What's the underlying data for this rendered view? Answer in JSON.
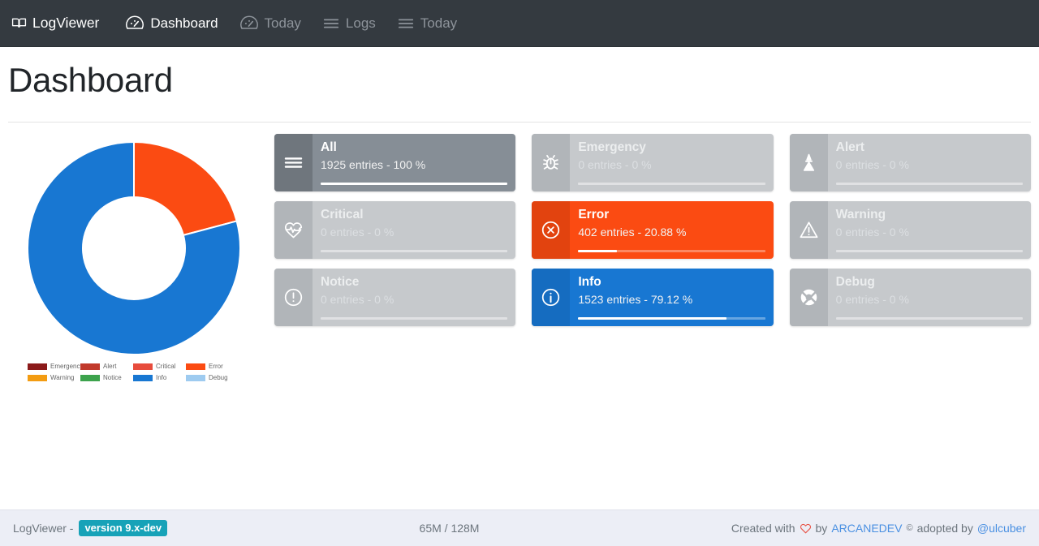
{
  "navbar": {
    "brand": {
      "label": "LogViewer",
      "icon": "book-open-icon"
    },
    "items": [
      {
        "label": "Dashboard",
        "icon": "tachometer-icon",
        "state": "active"
      },
      {
        "label": "Today",
        "icon": "tachometer-icon",
        "state": "muted"
      },
      {
        "label": "Logs",
        "icon": "list-icon",
        "state": "muted"
      },
      {
        "label": "Today",
        "icon": "list-icon",
        "state": "muted"
      }
    ]
  },
  "page": {
    "title": "Dashboard"
  },
  "chart_data": {
    "type": "pie",
    "title": "",
    "variant": "donut",
    "categories": [
      "Emergency",
      "Alert",
      "Critical",
      "Error",
      "Warning",
      "Notice",
      "Info",
      "Debug"
    ],
    "values": [
      0,
      0,
      0,
      402,
      0,
      0,
      1523,
      0
    ],
    "percentages": [
      0,
      0,
      0,
      20.88,
      0,
      0,
      79.12,
      0
    ],
    "colors": [
      "#8B1A1A",
      "#C1392B",
      "#E74C3C",
      "#FB4B12",
      "#F39C12",
      "#3DA34D",
      "#1877D2",
      "#9ECBF0"
    ],
    "legend_position": "bottom",
    "total": 1925,
    "start_angle": 0,
    "direction": "clockwise"
  },
  "cards": [
    {
      "key": "all",
      "title": "All",
      "stats": "1925 entries - 100 %",
      "entries": 1925,
      "percent": 100,
      "variant": "grey",
      "icon": "list-icon"
    },
    {
      "key": "emergency",
      "title": "Emergency",
      "stats": "0 entries - 0 %",
      "entries": 0,
      "percent": 0,
      "variant": "muted",
      "icon": "bug-icon"
    },
    {
      "key": "alert",
      "title": "Alert",
      "stats": "0 entries - 0 %",
      "entries": 0,
      "percent": 0,
      "variant": "muted",
      "icon": "bullhorn-icon"
    },
    {
      "key": "critical",
      "title": "Critical",
      "stats": "0 entries - 0 %",
      "entries": 0,
      "percent": 0,
      "variant": "muted",
      "icon": "heartbeat-icon"
    },
    {
      "key": "error",
      "title": "Error",
      "stats": "402 entries - 20.88 %",
      "entries": 402,
      "percent": 20.88,
      "variant": "danger",
      "icon": "times-circle-icon"
    },
    {
      "key": "warning",
      "title": "Warning",
      "stats": "0 entries - 0 %",
      "entries": 0,
      "percent": 0,
      "variant": "muted",
      "icon": "warning-triangle-icon"
    },
    {
      "key": "notice",
      "title": "Notice",
      "stats": "0 entries - 0 %",
      "entries": 0,
      "percent": 0,
      "variant": "muted",
      "icon": "exclamation-circle-icon"
    },
    {
      "key": "info",
      "title": "Info",
      "stats": "1523 entries - 79.12 %",
      "entries": 1523,
      "percent": 79.12,
      "variant": "info",
      "icon": "info-circle-icon"
    },
    {
      "key": "debug",
      "title": "Debug",
      "stats": "0 entries - 0 %",
      "entries": 0,
      "percent": 0,
      "variant": "muted",
      "icon": "life-ring-icon"
    }
  ],
  "footer": {
    "app_name": "LogViewer -",
    "version": "version 9.x-dev",
    "memory": "65M / 128M",
    "created_with": "Created with",
    "by": "by",
    "author": "ARCANEDEV",
    "copyright": "©",
    "adopted_by": "adopted by",
    "adopter": "@ulcuber",
    "heart_color": "#e8564a",
    "link_color": "#4a90e2",
    "badge_color": "#17a2b8"
  }
}
